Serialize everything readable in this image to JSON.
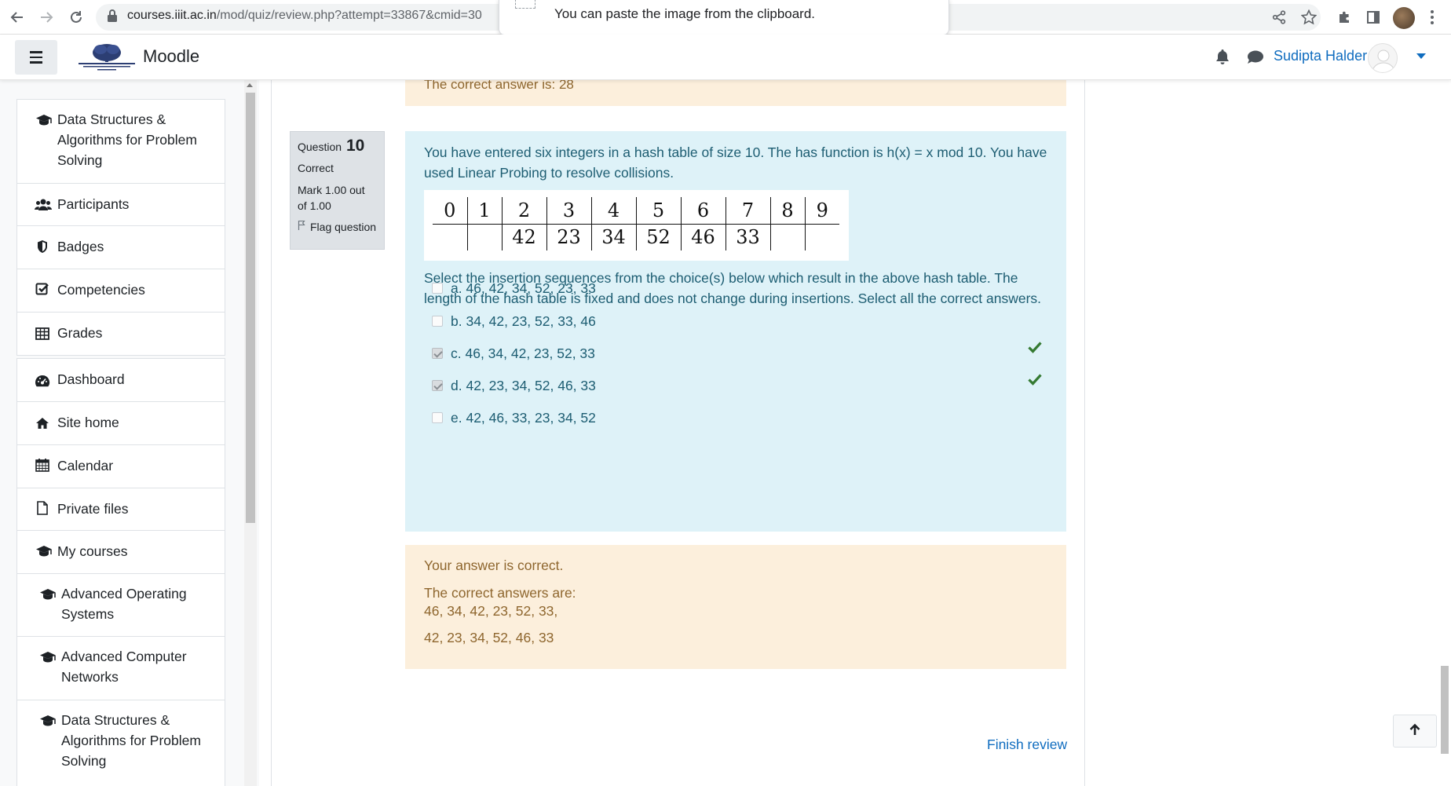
{
  "browser": {
    "url_domain": "courses.iiit.ac.in",
    "url_path": "/mod/quiz/review.php?attempt=33867&cmid=30",
    "clipboard_popup": "You can paste the image from the clipboard."
  },
  "navbar": {
    "site_name": "Moodle",
    "user_name": "Sudipta Halder"
  },
  "sidebar": {
    "course_items": [
      {
        "label": "Data Structures & Algorithms for Problem Solving",
        "icon": "graduation-cap-icon"
      },
      {
        "label": "Participants",
        "icon": "users-icon"
      },
      {
        "label": "Badges",
        "icon": "shield-icon"
      },
      {
        "label": "Competencies",
        "icon": "check-square-icon"
      },
      {
        "label": "Grades",
        "icon": "table-icon"
      }
    ],
    "site_items": [
      {
        "label": "Dashboard",
        "icon": "dashboard-icon"
      },
      {
        "label": "Site home",
        "icon": "home-icon"
      },
      {
        "label": "Calendar",
        "icon": "calendar-icon"
      },
      {
        "label": "Private files",
        "icon": "file-icon"
      },
      {
        "label": "My courses",
        "icon": "graduation-cap-icon"
      },
      {
        "label": "Advanced Operating Systems",
        "icon": "graduation-cap-icon"
      },
      {
        "label": "Advanced Computer Networks",
        "icon": "graduation-cap-icon"
      },
      {
        "label": "Data Structures & Algorithms for Problem Solving",
        "icon": "graduation-cap-icon"
      }
    ]
  },
  "previous_feedback": {
    "text": "The correct answer is: 28"
  },
  "question": {
    "label": "Question",
    "number": "10",
    "state": "Correct",
    "grade": "Mark 1.00 out of 1.00",
    "flag": "Flag question",
    "text1": "You have entered six integers in a hash table of size 10. The has function is h(x) = x mod 10. You have used Linear Probing to resolve collisions.",
    "table_indices": [
      "0",
      "1",
      "2",
      "3",
      "4",
      "5",
      "6",
      "7",
      "8",
      "9"
    ],
    "table_values": [
      "",
      "",
      "42",
      "23",
      "34",
      "52",
      "46",
      "33",
      "",
      ""
    ],
    "text2": "Select the insertion sequences from the choice(s) below which result in the above hash table. The length of the hash table is fixed and does not change during insertions. Select all the correct answers.",
    "options": [
      {
        "label": "a. 46, 42, 34, 52, 23, 33",
        "checked": false,
        "correct": false
      },
      {
        "label": "b. 34, 42, 23, 52, 33, 46",
        "checked": false,
        "correct": false
      },
      {
        "label": "c. 46, 34, 42, 23, 52, 33",
        "checked": true,
        "correct": true
      },
      {
        "label": "d. 42, 23, 34, 52, 46, 33",
        "checked": true,
        "correct": true
      },
      {
        "label": "e. 42, 46, 33, 23, 34, 52",
        "checked": false,
        "correct": false
      }
    ]
  },
  "feedback": {
    "result": "Your answer is correct.",
    "label": "The correct answers are:",
    "answer1": "46, 34, 42, 23, 52, 33,",
    "answer2": "42, 23, 34, 52, 46, 33"
  },
  "footer": {
    "finish_review": "Finish review"
  },
  "colors": {
    "link": "#0f6cbf",
    "question_bg": "#def2f8",
    "feedback_bg": "#fcefdc",
    "correct_tick": "#357a32"
  }
}
